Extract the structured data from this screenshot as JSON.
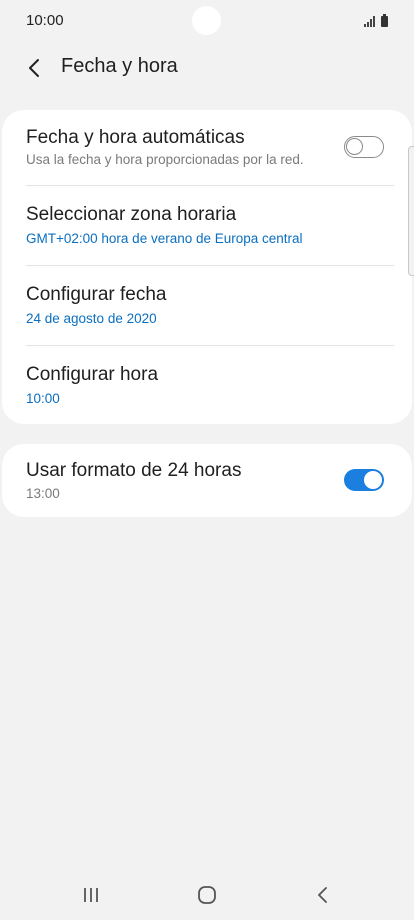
{
  "status_bar": {
    "time": "10:00",
    "icons": [
      "signal-icon",
      "battery-icon"
    ]
  },
  "header": {
    "title": "Fecha y hora",
    "back_icon": "chevron-left-icon"
  },
  "settings": [
    {
      "title": "Fecha y hora automáticas",
      "subtitle": "Usa la fecha y hora proporcionadas por la red.",
      "toggle": "off"
    },
    {
      "title": "Seleccionar zona horaria",
      "subtitle": "GMT+02:00 hora de verano de Europa central"
    },
    {
      "title": "Configurar fecha",
      "subtitle": "24 de agosto de 2020"
    },
    {
      "title": "Configurar hora",
      "subtitle": "10:00"
    }
  ],
  "format_setting": {
    "title": "Usar formato de 24 horas",
    "subtitle": "13:00",
    "toggle": "on"
  },
  "nav_bar": {
    "icons": [
      "recent-apps-icon",
      "home-icon",
      "back-icon"
    ]
  },
  "colors": {
    "accent": "#1a7fdf",
    "link_text": "#0a6fc0",
    "background": "#f2f2f2"
  }
}
